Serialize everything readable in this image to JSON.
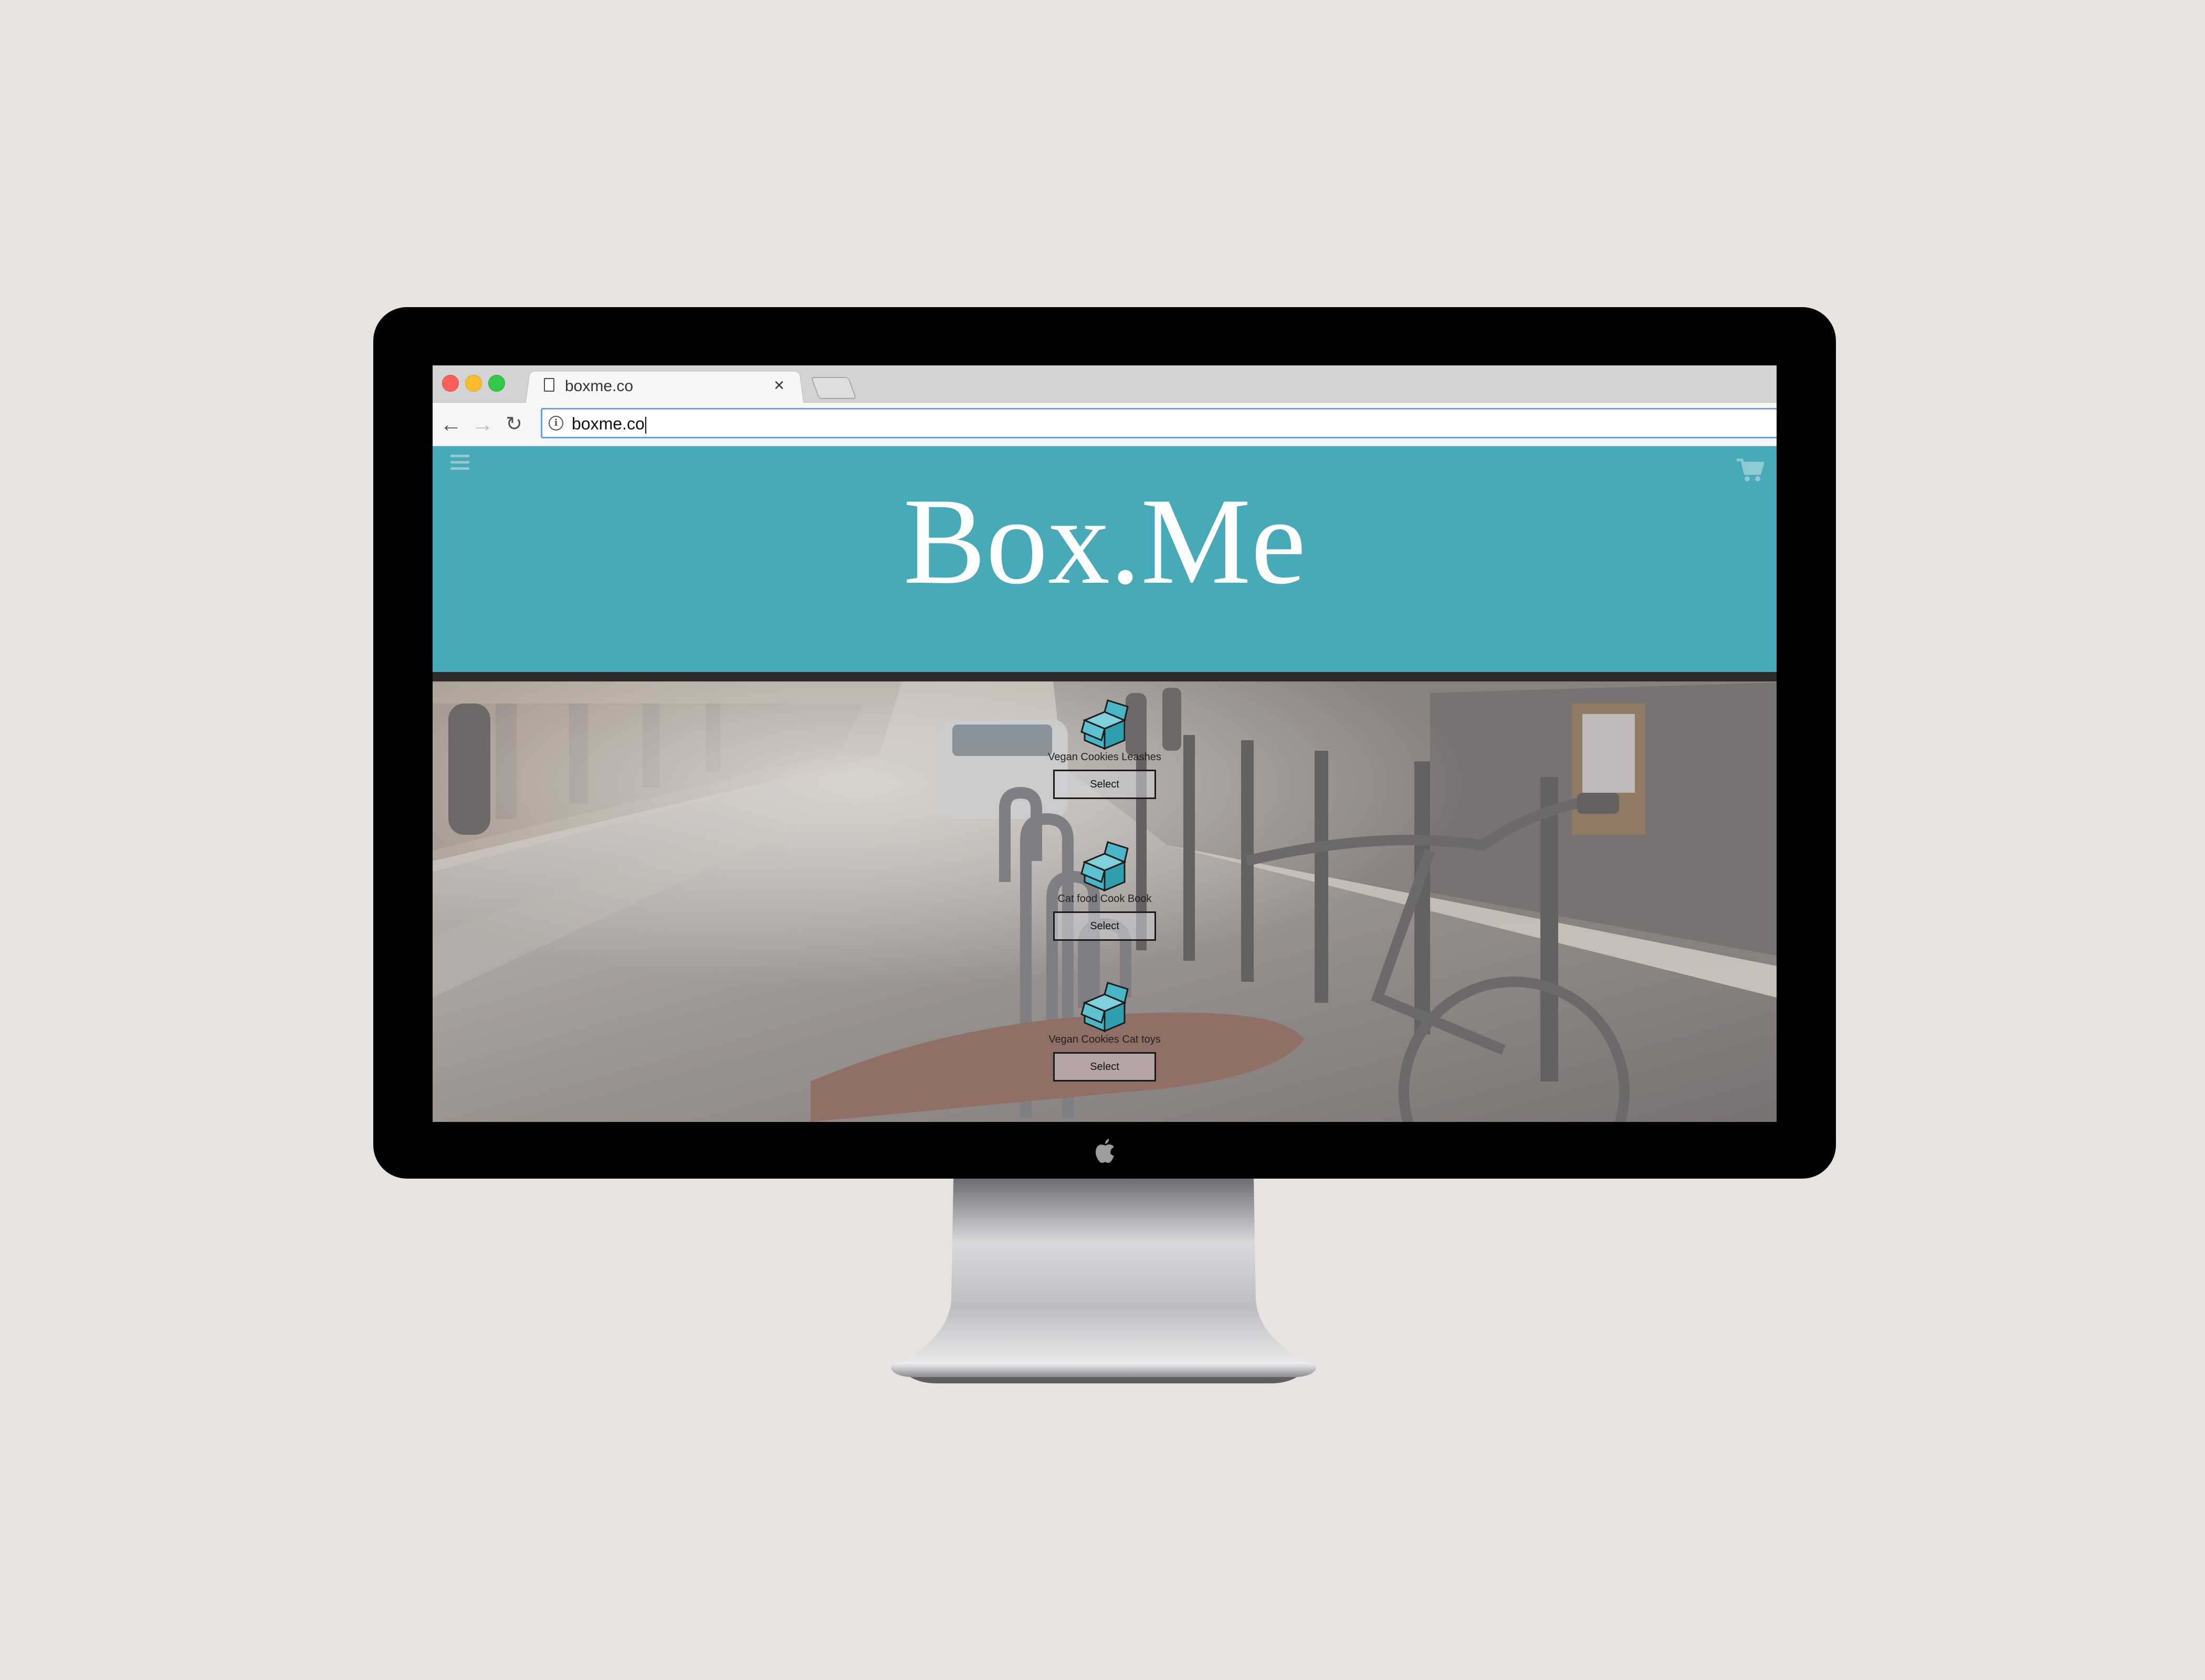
{
  "browser": {
    "tab_title": "boxme.co",
    "tab_close": "×",
    "url": "boxme.co",
    "nav": {
      "back": "←",
      "forward": "→",
      "reload": "↻"
    },
    "info_glyph": "i"
  },
  "site": {
    "brand": "Box.Me",
    "accent_color": "#48a9b9",
    "icons": {
      "menu": "hamburger-menu-icon",
      "cart": "shopping-cart-icon",
      "box": "open-box-icon",
      "apple": "apple-logo-icon"
    }
  },
  "products": [
    {
      "label": "Vegan Cookies Leashes",
      "button": "Select"
    },
    {
      "label": "Cat food Cook Book",
      "button": "Select"
    },
    {
      "label": "Vegan Cookies Cat toys",
      "button": "Select"
    }
  ],
  "device": {
    "apple_glyph": ""
  }
}
